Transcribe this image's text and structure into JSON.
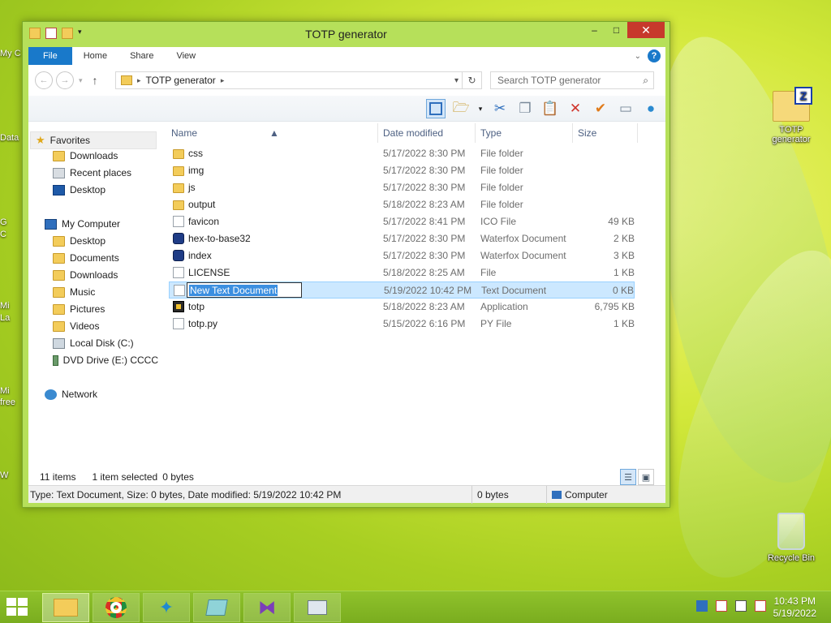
{
  "window": {
    "title": "TOTP generator",
    "minimize_glyph": "–",
    "maximize_glyph": "□",
    "close_glyph": "✕"
  },
  "ribbon": {
    "tabs": [
      {
        "label": "File"
      },
      {
        "label": "Home"
      },
      {
        "label": "Share"
      },
      {
        "label": "View"
      }
    ],
    "help_glyph": "?"
  },
  "address": {
    "crumb": "TOTP generator",
    "search_placeholder": "Search TOTP generator"
  },
  "nav": {
    "favorites": {
      "label": "Favorites",
      "items": [
        "Downloads",
        "Recent places",
        "Desktop"
      ]
    },
    "computer": {
      "label": "My Computer",
      "items": [
        "Desktop",
        "Documents",
        "Downloads",
        "Music",
        "Pictures",
        "Videos",
        "Local Disk (C:)",
        "DVD Drive (E:) CCCC"
      ]
    },
    "network": {
      "label": "Network"
    }
  },
  "columns": {
    "name": "Name",
    "date": "Date modified",
    "type": "Type",
    "size": "Size"
  },
  "files": [
    {
      "name": "css",
      "date": "5/17/2022 8:30 PM",
      "type": "File folder",
      "size": "",
      "icon": "folder-icon"
    },
    {
      "name": "img",
      "date": "5/17/2022 8:30 PM",
      "type": "File folder",
      "size": "",
      "icon": "folder-icon"
    },
    {
      "name": "js",
      "date": "5/17/2022 8:30 PM",
      "type": "File folder",
      "size": "",
      "icon": "folder-icon"
    },
    {
      "name": "output",
      "date": "5/18/2022 8:23 AM",
      "type": "File folder",
      "size": "",
      "icon": "folder-icon"
    },
    {
      "name": "favicon",
      "date": "5/17/2022 8:41 PM",
      "type": "ICO File",
      "size": "49 KB",
      "icon": "document-icon"
    },
    {
      "name": "hex-to-base32",
      "date": "5/17/2022 8:30 PM",
      "type": "Waterfox Document",
      "size": "2 KB",
      "icon": "waterfox-document-icon"
    },
    {
      "name": "index",
      "date": "5/17/2022 8:30 PM",
      "type": "Waterfox Document",
      "size": "3 KB",
      "icon": "waterfox-document-icon"
    },
    {
      "name": "LICENSE",
      "date": "5/18/2022 8:25 AM",
      "type": "File",
      "size": "1 KB",
      "icon": "document-icon"
    },
    {
      "name": "New Text Document",
      "date": "5/19/2022 10:42 PM",
      "type": "Text Document",
      "size": "0 KB",
      "icon": "text-document-icon",
      "selected": true
    },
    {
      "name": "totp",
      "date": "5/18/2022 8:23 AM",
      "type": "Application",
      "size": "6,795 KB",
      "icon": "application-icon"
    },
    {
      "name": "totp.py",
      "date": "5/15/2022 6:16 PM",
      "type": "PY File",
      "size": "1 KB",
      "icon": "document-icon"
    }
  ],
  "status": {
    "count": "11 items",
    "selection": "1 item selected",
    "selection_size": "0 bytes"
  },
  "details": {
    "info": "Type: Text Document, Size: 0 bytes, Date modified: 5/19/2022 10:42 PM",
    "size": "0 bytes",
    "location": "Computer"
  },
  "desktop": {
    "zip_label": "TOTP generator",
    "recycle_label": "Recycle Bin",
    "partial_labels": [
      "My C",
      "Data",
      "G",
      "C",
      "Mi",
      "La",
      "Mi",
      "free",
      "W"
    ]
  },
  "clock": {
    "time": "10:43 PM",
    "date": "5/19/2022"
  },
  "colors": {
    "accent": "#1979ca",
    "selection": "#cce8ff",
    "close_button": "#c7392c",
    "window_frame": "#b6e05a"
  }
}
